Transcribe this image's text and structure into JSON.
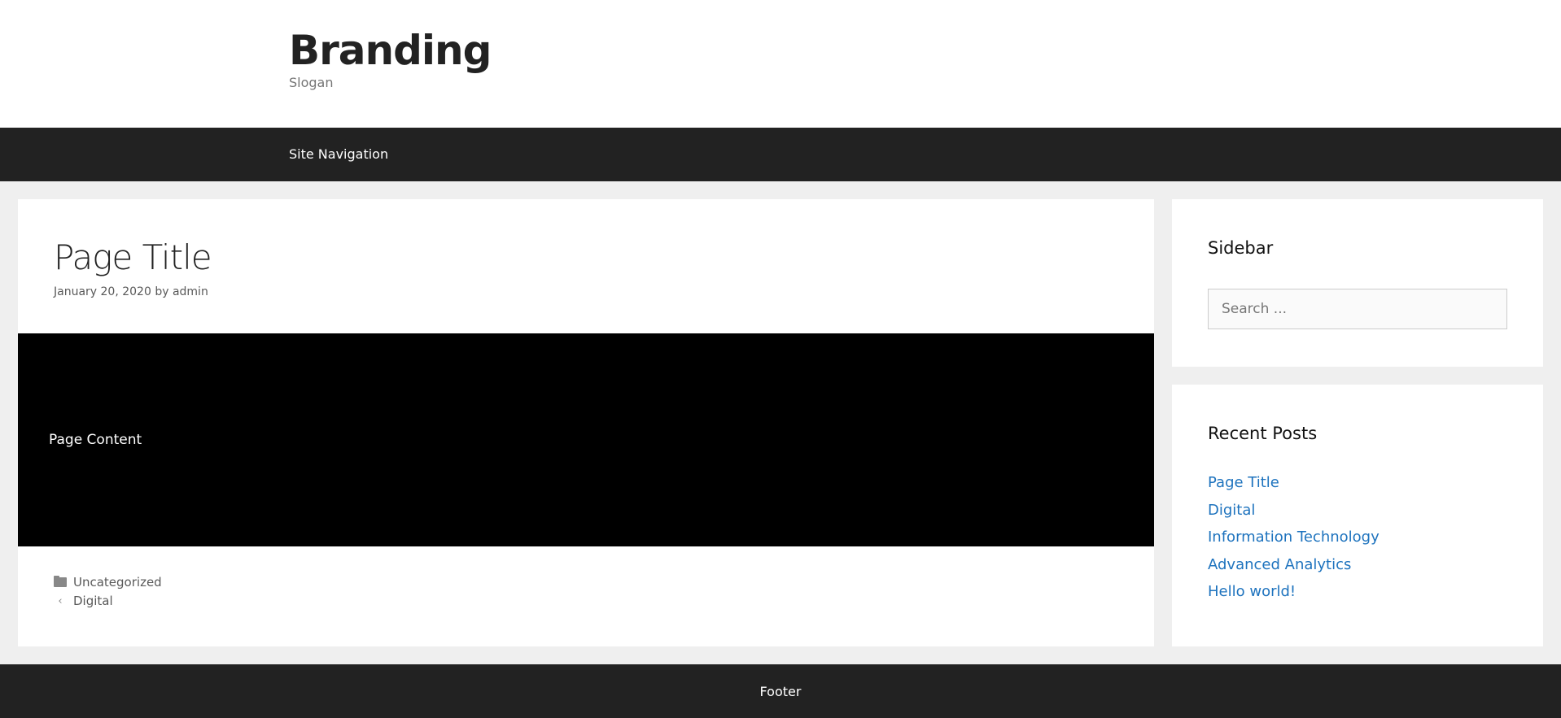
{
  "header": {
    "branding": "Branding",
    "slogan": "Slogan"
  },
  "nav": {
    "label": "Site Navigation"
  },
  "article": {
    "title": "Page Title",
    "date": "January 20, 2020",
    "by": "by",
    "author": "admin",
    "content": "Page Content",
    "category": "Uncategorized",
    "previous_post": "Digital",
    "icons": {
      "category": "folder-icon",
      "previous": "chevron-left-icon"
    }
  },
  "sidebar": {
    "widget_title": "Sidebar",
    "search_placeholder": "Search ...",
    "recent_title": "Recent Posts",
    "recent_posts": [
      "Page Title",
      "Digital",
      "Information Technology",
      "Advanced Analytics",
      "Hello world!"
    ]
  },
  "footer": {
    "text": "Footer"
  },
  "colors": {
    "dark_bar": "#222222",
    "link": "#1e73be",
    "background": "#efefef"
  }
}
